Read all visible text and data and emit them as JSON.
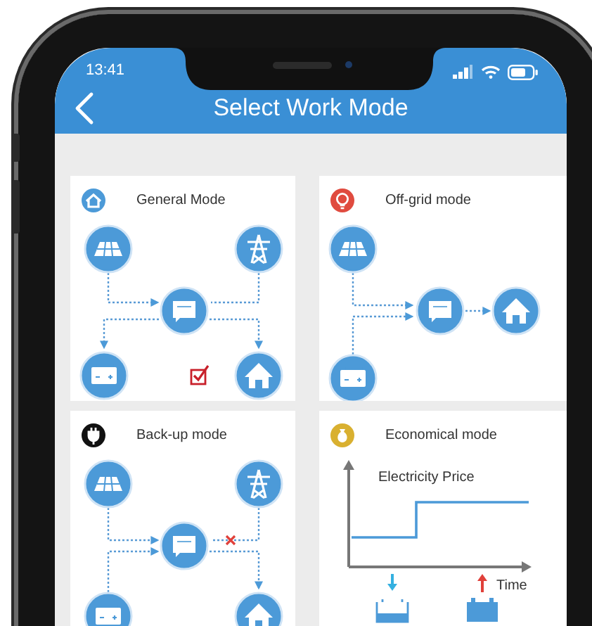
{
  "status_bar": {
    "time": "13:41"
  },
  "header": {
    "title": "Select Work Mode"
  },
  "modes": [
    {
      "kind": "general",
      "title": "General Mode",
      "selected": true
    },
    {
      "kind": "off-grid",
      "title": "Off-grid mode",
      "selected": false
    },
    {
      "kind": "back-up",
      "title": "Back-up mode",
      "selected": false
    },
    {
      "kind": "economical",
      "title": "Economical mode",
      "selected": false,
      "chart_title": "Electricity Price",
      "axis_label": "Time"
    }
  ]
}
